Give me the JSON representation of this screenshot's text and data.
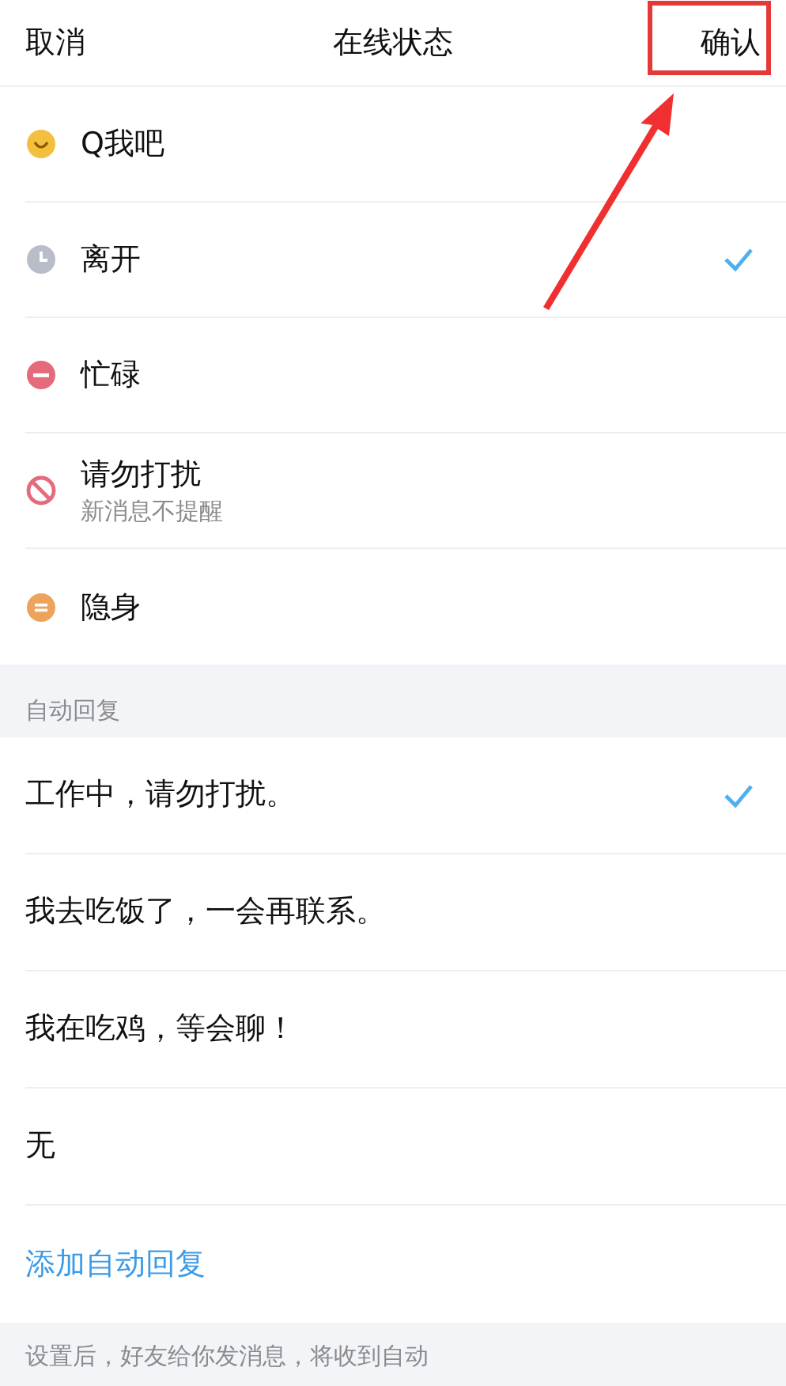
{
  "header": {
    "cancel": "取消",
    "title": "在线状态",
    "confirm": "确认"
  },
  "statuses": [
    {
      "kind": "smile",
      "label": "Q我吧",
      "selected": false
    },
    {
      "kind": "clock",
      "label": "离开",
      "selected": true
    },
    {
      "kind": "busy",
      "label": "忙碌",
      "selected": false
    },
    {
      "kind": "forbidden",
      "label": "请勿打扰",
      "sublabel": "新消息不提醒",
      "selected": false
    },
    {
      "kind": "invisible",
      "label": "隐身",
      "selected": false
    }
  ],
  "auto_reply": {
    "section_title": "自动回复",
    "replies": [
      {
        "text": "工作中，请勿打扰。",
        "selected": true
      },
      {
        "text": "我去吃饭了，一会再联系。",
        "selected": false
      },
      {
        "text": "我在吃鸡，等会聊！",
        "selected": false
      },
      {
        "text": "无",
        "selected": false
      }
    ],
    "add_link": "添加自动回复",
    "footer_note": "设置后，好友给你发消息，将收到自动"
  }
}
